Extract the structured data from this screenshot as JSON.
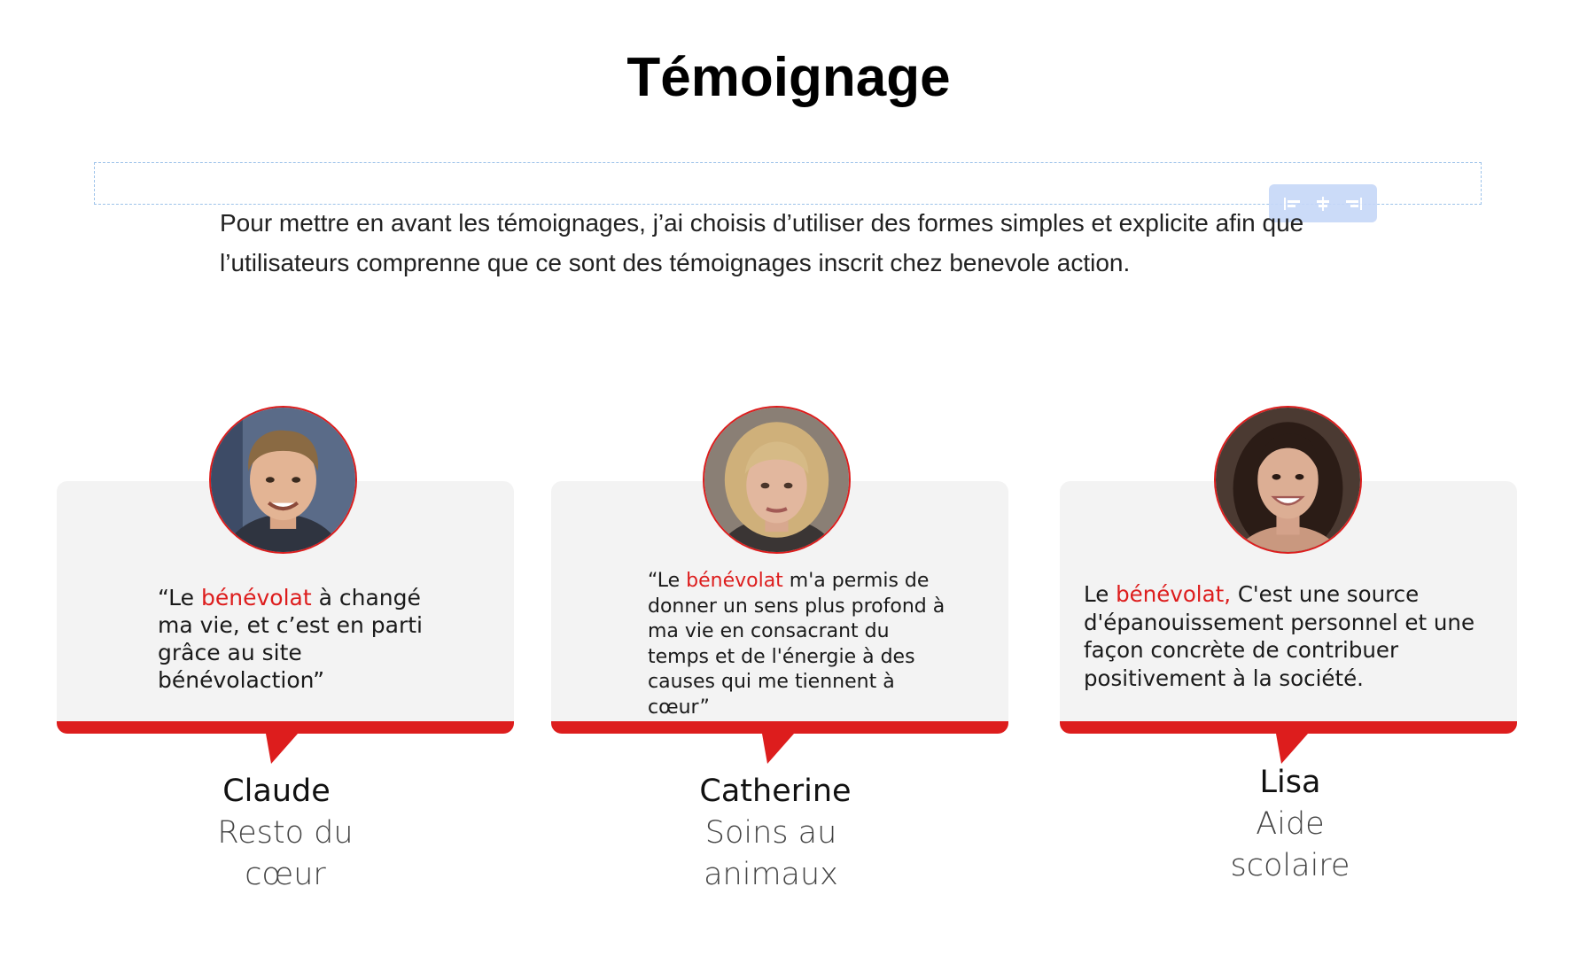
{
  "page": {
    "title": "Témoignage",
    "intro": "Pour mettre en avant les témoignages, j’ai choisis d’utiliser des formes simples et explicite afin que l’utilisateurs comprenne que ce sont des témoignages inscrit chez benevole action."
  },
  "editor": {
    "toolbar_icons": [
      "align-left-icon",
      "align-center-icon",
      "align-right-icon"
    ]
  },
  "colors": {
    "accent": "#dd1d1d",
    "card_bg": "#f3f3f3"
  },
  "testimonials": [
    {
      "quote_before": "“Le ",
      "quote_highlight": "bénévolat",
      "quote_after": " à changé ma vie, et c’est en parti grâce au site bénévolaction”",
      "name": "Claude",
      "org_line1": "Resto du",
      "org_line2": "cœur"
    },
    {
      "quote_before": "“Le ",
      "quote_highlight": "bénévolat",
      "quote_after": " m'a permis de donner un sens plus profond à ma vie en consacrant du temps et de l'énergie à des causes qui me tiennent à cœur”",
      "name": "Catherine",
      "org_line1": "Soins au",
      "org_line2": "animaux"
    },
    {
      "quote_before": "Le ",
      "quote_highlight": "bénévolat,",
      "quote_after": " C'est une source d'épanouissement personnel et une façon concrète de contribuer positivement à la société.",
      "name": "Lisa",
      "org_line1": "Aide",
      "org_line2": "scolaire"
    }
  ]
}
